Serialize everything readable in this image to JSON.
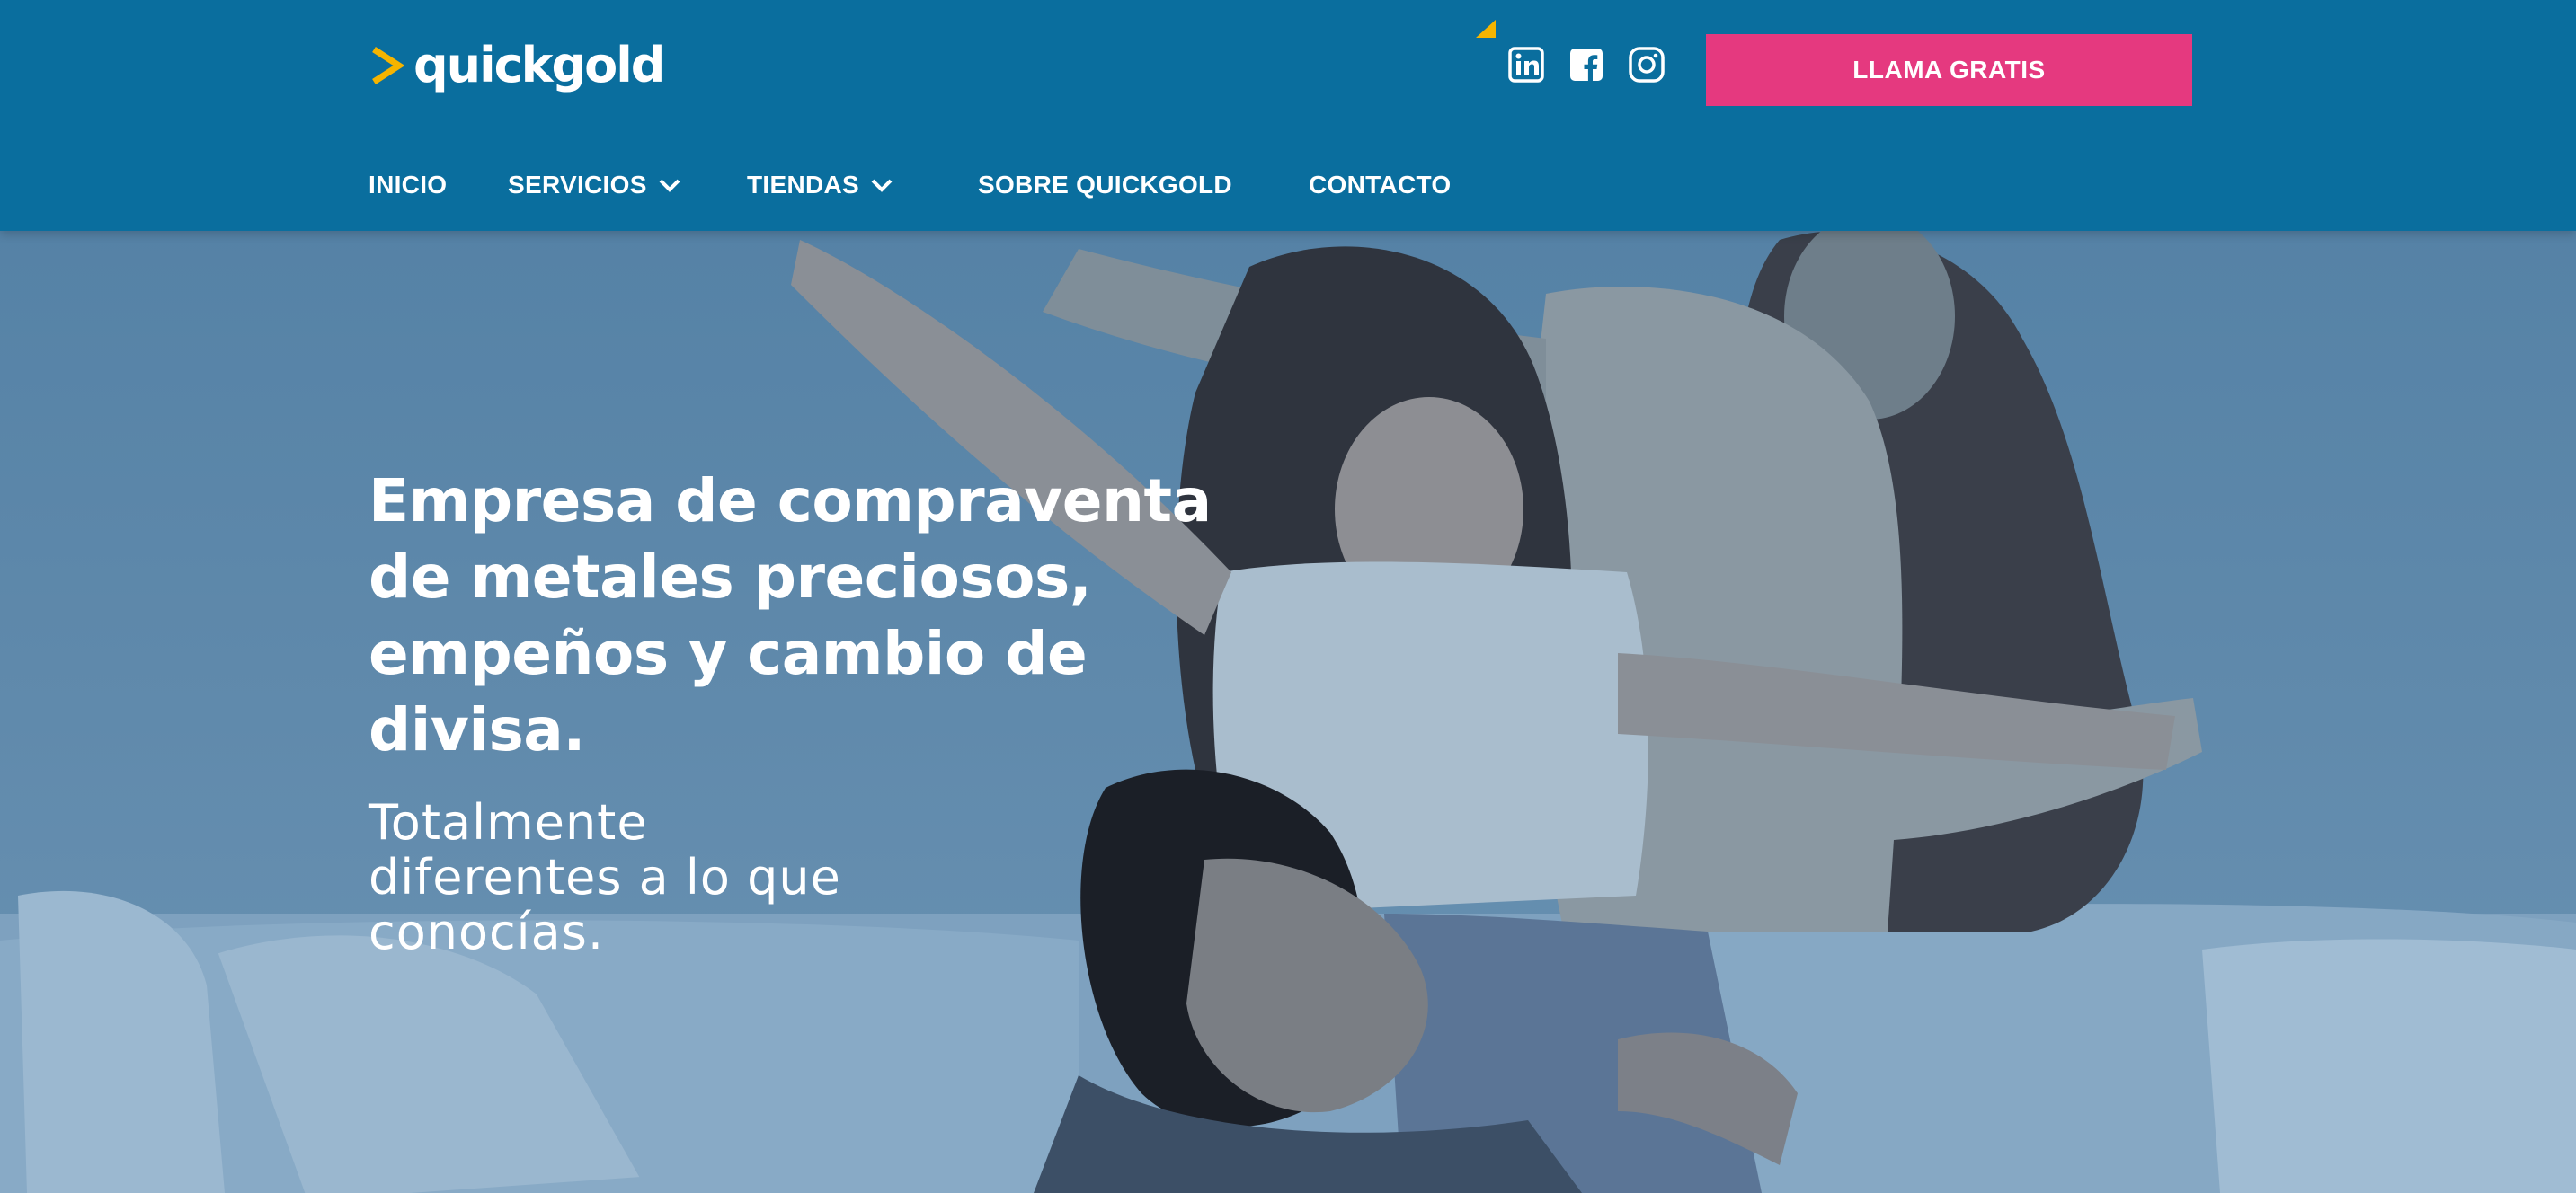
{
  "header": {
    "logo_text": "quickgold",
    "cta_label": "LLAMA GRATIS",
    "social_icons": [
      "linkedin-icon",
      "facebook-icon",
      "instagram-icon"
    ],
    "nav": {
      "inicio": "INICIO",
      "servicios": "SERVICIOS",
      "tiendas": "TIENDAS",
      "sobre": "SOBRE QUICKGOLD",
      "contacto": "CONTACTO"
    }
  },
  "hero": {
    "heading_lines": [
      "Empresa de compraventa",
      "de metales preciosos,",
      "empeños y cambio de",
      "divisa."
    ],
    "subheading_lines": [
      "Totalmente",
      "diferentes a lo que",
      "conocías."
    ]
  },
  "colors": {
    "header_bg": "#0a6e9e",
    "cta_bg": "#e5397f",
    "logo_accent": "#f5b400",
    "text": "#ffffff"
  }
}
